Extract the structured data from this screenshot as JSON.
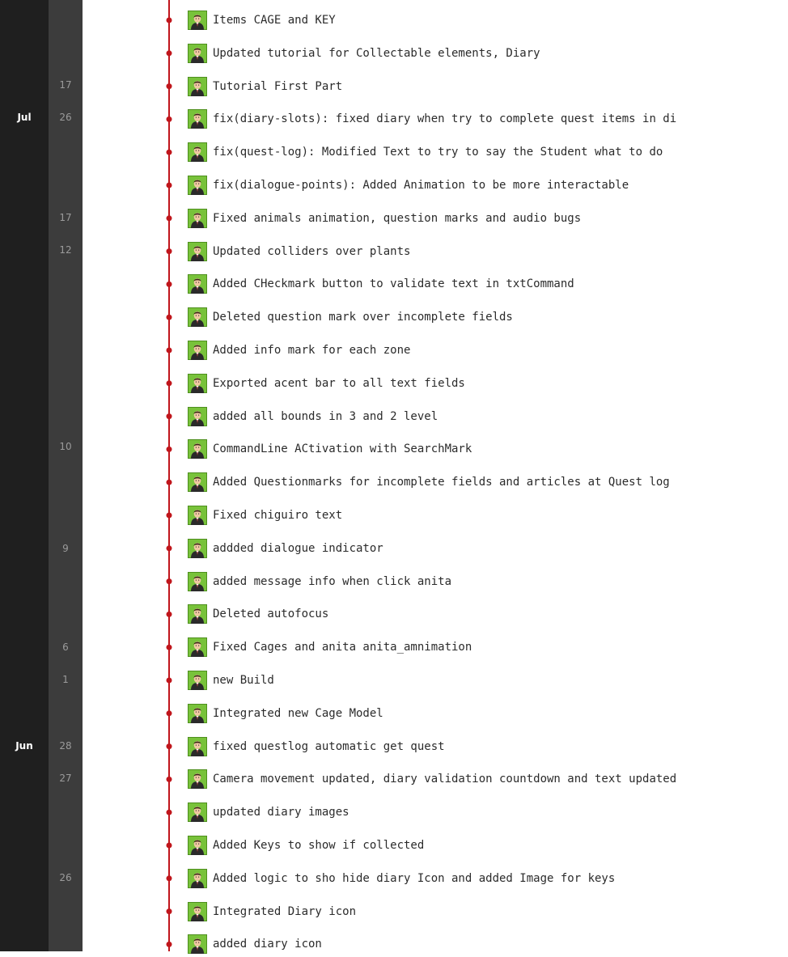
{
  "timeline": {
    "months": [
      {
        "label": "Jul"
      },
      {
        "label": "Jun"
      }
    ],
    "days": [
      "17",
      "26",
      "17",
      "12",
      "10",
      "9",
      "6",
      "1",
      "28",
      "27",
      "26"
    ]
  },
  "colors": {
    "graph_line": "#c0161c",
    "month_column": "#1f1f1f",
    "day_column": "#3c3c3c"
  },
  "commits": [
    {
      "message": "Items CAGE and KEY",
      "avatar": "author-avatar-icon"
    },
    {
      "message": "Updated tutorial for Collectable elements, Diary",
      "avatar": "author-avatar-icon"
    },
    {
      "message": "Tutorial First Part",
      "avatar": "author-avatar-icon"
    },
    {
      "message": "fix(diary-slots): fixed diary when try to complete quest items in di",
      "avatar": "author-avatar-icon"
    },
    {
      "message": "fix(quest-log): Modified Text to try to say the Student what to do",
      "avatar": "author-avatar-icon"
    },
    {
      "message": "fix(dialogue-points): Added Animation to be more interactable",
      "avatar": "author-avatar-icon"
    },
    {
      "message": "Fixed animals animation, question marks and audio bugs",
      "avatar": "author-avatar-icon"
    },
    {
      "message": "Updated colliders over plants",
      "avatar": "author-avatar-icon"
    },
    {
      "message": "Added CHeckmark button to validate text in txtCommand",
      "avatar": "author-avatar-icon"
    },
    {
      "message": "Deleted question mark over incomplete fields",
      "avatar": "author-avatar-icon"
    },
    {
      "message": "Added info mark for each zone",
      "avatar": "author-avatar-icon"
    },
    {
      "message": "Exported acent bar to all text fields",
      "avatar": "author-avatar-icon"
    },
    {
      "message": "added all bounds in 3 and 2 level",
      "avatar": "author-avatar-icon"
    },
    {
      "message": "CommandLine ACtivation with SearchMark",
      "avatar": "author-avatar-icon"
    },
    {
      "message": "Added Questionmarks for incomplete fields and articles at Quest log",
      "avatar": "author-avatar-icon"
    },
    {
      "message": "Fixed chiguiro text",
      "avatar": "author-avatar-icon"
    },
    {
      "message": "addded dialogue indicator",
      "avatar": "author-avatar-icon"
    },
    {
      "message": "added message info when click anita",
      "avatar": "author-avatar-icon"
    },
    {
      "message": "Deleted autofocus",
      "avatar": "author-avatar-icon"
    },
    {
      "message": "Fixed Cages and anita anita_amnimation",
      "avatar": "author-avatar-icon"
    },
    {
      "message": "new Build",
      "avatar": "author-avatar-icon"
    },
    {
      "message": "Integrated new Cage Model",
      "avatar": "author-avatar-icon"
    },
    {
      "message": "fixed questlog automatic get quest",
      "avatar": "author-avatar-icon"
    },
    {
      "message": "Camera movement updated, diary validation countdown and text updated",
      "avatar": "author-avatar-icon"
    },
    {
      "message": "updated diary images",
      "avatar": "author-avatar-icon"
    },
    {
      "message": "Added Keys to show if collected",
      "avatar": "author-avatar-icon"
    },
    {
      "message": "Added logic to sho hide diary Icon and added Image for keys",
      "avatar": "author-avatar-icon"
    },
    {
      "message": "Integrated Diary icon",
      "avatar": "author-avatar-icon"
    },
    {
      "message": "added diary icon",
      "avatar": "author-avatar-icon"
    }
  ]
}
